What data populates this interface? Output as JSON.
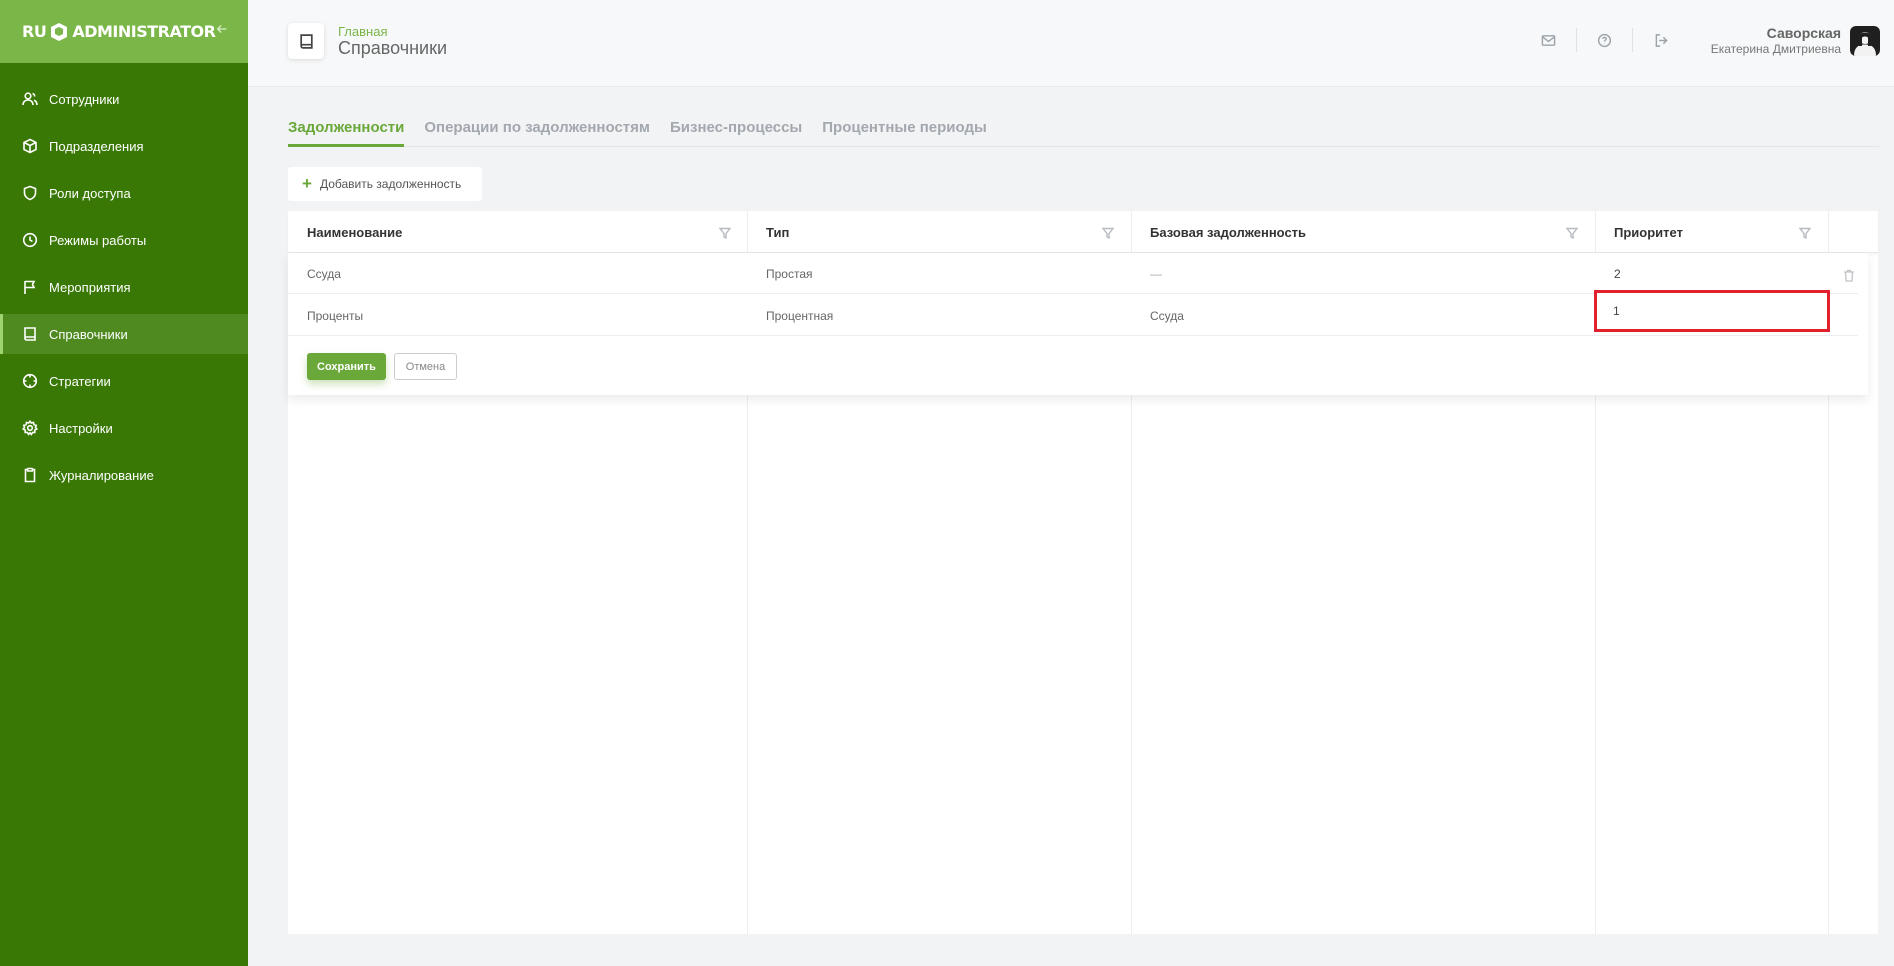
{
  "sidebar": {
    "logo_left": "RU",
    "logo_right": "ADMINISTRATOR",
    "items": [
      {
        "label": "Сотрудники",
        "icon": "users-icon"
      },
      {
        "label": "Подразделения",
        "icon": "cube-icon"
      },
      {
        "label": "Роли доступа",
        "icon": "shield-icon"
      },
      {
        "label": "Режимы работы",
        "icon": "clock-icon"
      },
      {
        "label": "Мероприятия",
        "icon": "flag-icon"
      },
      {
        "label": "Справочники",
        "icon": "book-icon",
        "active": true
      },
      {
        "label": "Стратегии",
        "icon": "crosshair-icon"
      },
      {
        "label": "Настройки",
        "icon": "gear-icon"
      },
      {
        "label": "Журналирование",
        "icon": "clipboard-icon"
      }
    ]
  },
  "header": {
    "breadcrumb": "Главная",
    "title": "Справочники",
    "user_last_name": "Саворская",
    "user_first_name": "Екатерина Дмитриевна"
  },
  "tabs": [
    {
      "label": "Задолженности",
      "active": true
    },
    {
      "label": "Операции по задолженностям"
    },
    {
      "label": "Бизнес-процессы"
    },
    {
      "label": "Процентные периоды"
    }
  ],
  "add_button_label": "Добавить задолженность",
  "table": {
    "columns": [
      "Наименование",
      "Тип",
      "Базовая задолженность",
      "Приоритет"
    ],
    "rows": [
      [
        "Ссуда",
        "Простая",
        "—",
        "2"
      ],
      [
        "Проценты",
        "Процентная",
        "Ссуда",
        "1"
      ]
    ]
  },
  "actions": {
    "save_label": "Сохранить",
    "cancel_label": "Отмена"
  },
  "colors": {
    "sidebar": "#3a7806",
    "sidebar_header": "#7ab648",
    "accent": "#6aa83a",
    "highlight": "#e0202c"
  }
}
